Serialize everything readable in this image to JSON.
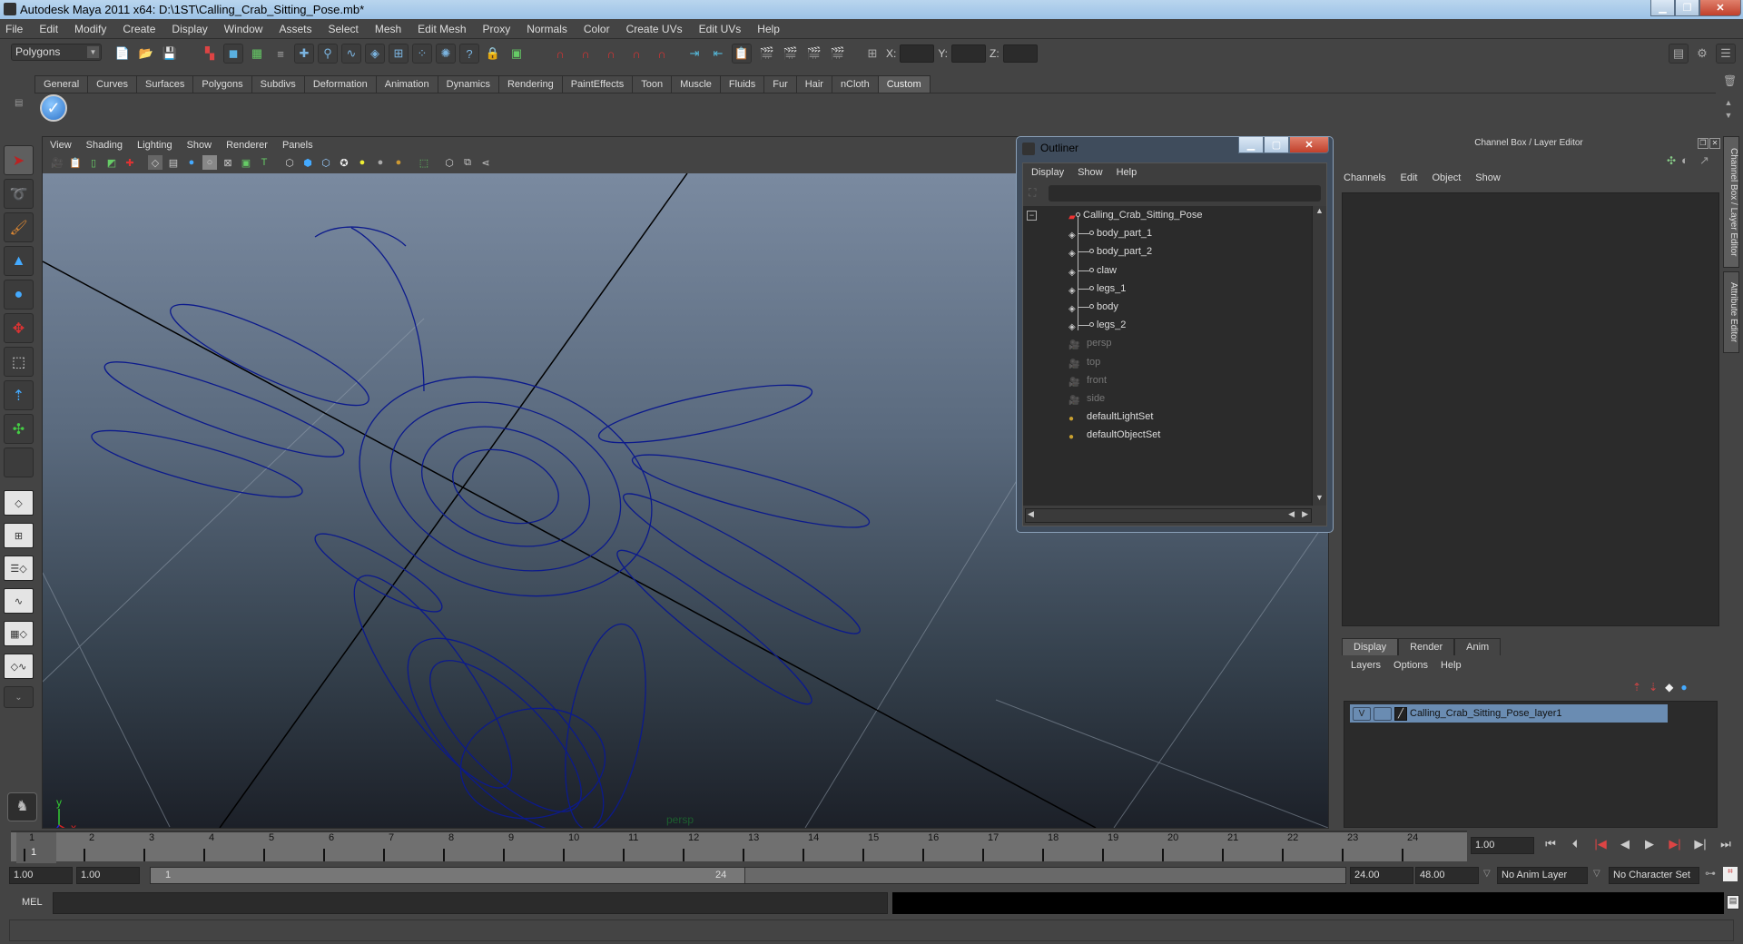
{
  "window": {
    "title": "Autodesk Maya 2011 x64: D:\\1ST\\Calling_Crab_Sitting_Pose.mb*",
    "controls": [
      "minimize",
      "restore",
      "close"
    ]
  },
  "menubar": [
    "File",
    "Edit",
    "Modify",
    "Create",
    "Display",
    "Window",
    "Assets",
    "Select",
    "Mesh",
    "Edit Mesh",
    "Proxy",
    "Normals",
    "Color",
    "Create UVs",
    "Edit UVs",
    "Help"
  ],
  "toolbar": {
    "mode_select": "Polygons",
    "x_label": "X:",
    "y_label": "Y:",
    "z_label": "Z:"
  },
  "shelf": {
    "tabs": [
      "General",
      "Curves",
      "Surfaces",
      "Polygons",
      "Subdivs",
      "Deformation",
      "Animation",
      "Dynamics",
      "Rendering",
      "PaintEffects",
      "Toon",
      "Muscle",
      "Fluids",
      "Fur",
      "Hair",
      "nCloth",
      "Custom"
    ],
    "active_tab": "Custom"
  },
  "viewport": {
    "menu": [
      "View",
      "Shading",
      "Lighting",
      "Show",
      "Renderer",
      "Panels"
    ],
    "camera_label": "persp",
    "axis": {
      "x": "x",
      "y": "y",
      "z": "z"
    },
    "wireframe_color": "#0c1a8c"
  },
  "outliner": {
    "title": "Outliner",
    "menu": [
      "Display",
      "Show",
      "Help"
    ],
    "items": [
      {
        "label": "Calling_Crab_Sitting_Pose",
        "type": "group",
        "depth": 0,
        "dim": false
      },
      {
        "label": "body_part_1",
        "type": "mesh",
        "depth": 1,
        "dim": false
      },
      {
        "label": "body_part_2",
        "type": "mesh",
        "depth": 1,
        "dim": false
      },
      {
        "label": "claw",
        "type": "mesh",
        "depth": 1,
        "dim": false
      },
      {
        "label": "legs_1",
        "type": "mesh",
        "depth": 1,
        "dim": false
      },
      {
        "label": "body",
        "type": "mesh",
        "depth": 1,
        "dim": false
      },
      {
        "label": "legs_2",
        "type": "mesh",
        "depth": 1,
        "dim": false
      },
      {
        "label": "persp",
        "type": "camera",
        "depth": 0,
        "dim": true
      },
      {
        "label": "top",
        "type": "camera",
        "depth": 0,
        "dim": true
      },
      {
        "label": "front",
        "type": "camera",
        "depth": 0,
        "dim": true
      },
      {
        "label": "side",
        "type": "camera",
        "depth": 0,
        "dim": true
      },
      {
        "label": "defaultLightSet",
        "type": "set",
        "depth": 0,
        "dim": false
      },
      {
        "label": "defaultObjectSet",
        "type": "set",
        "depth": 0,
        "dim": false
      }
    ]
  },
  "channel_box": {
    "title": "Channel Box / Layer Editor",
    "menu": [
      "Channels",
      "Edit",
      "Object",
      "Show"
    ],
    "layer_tabs": [
      "Display",
      "Render",
      "Anim"
    ],
    "active_layer_tab": "Display",
    "layer_menu": [
      "Layers",
      "Options",
      "Help"
    ],
    "layers": [
      {
        "visible": "V",
        "name": "Calling_Crab_Sitting_Pose_layer1"
      }
    ]
  },
  "side_tabs": [
    "Channel Box / Layer Editor",
    "Attribute Editor"
  ],
  "timeline": {
    "ticks": [
      "1",
      "2",
      "3",
      "4",
      "5",
      "6",
      "7",
      "8",
      "9",
      "10",
      "11",
      "12",
      "13",
      "14",
      "15",
      "16",
      "17",
      "18",
      "19",
      "20",
      "21",
      "22",
      "23",
      "24"
    ],
    "current_frame_marker": "1",
    "current_frame": "1.00"
  },
  "range": {
    "start": "1.00",
    "playback_start": "1.00",
    "slider_start": "1",
    "slider_end": "24",
    "playback_end": "24.00",
    "end": "48.00",
    "anim_layer": "No Anim Layer",
    "character_set": "No Character Set"
  },
  "command_line": {
    "label": "MEL",
    "input": "",
    "output": ""
  }
}
